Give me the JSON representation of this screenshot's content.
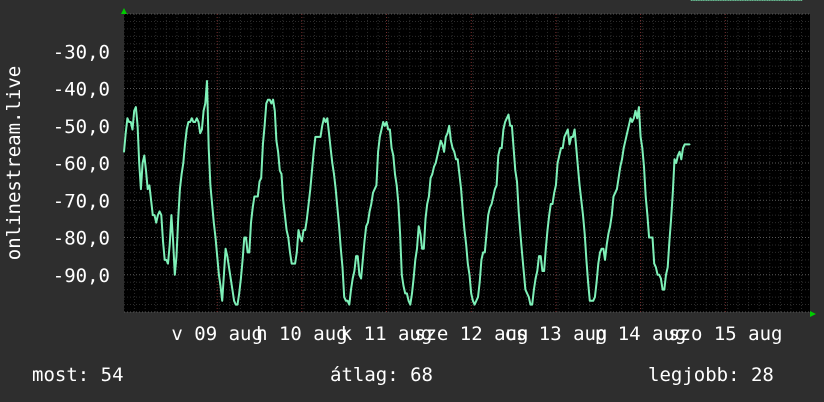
{
  "chart_data": {
    "type": "line",
    "ylabel": "onlinestream.live",
    "ylim": [
      -100,
      -20
    ],
    "yticks": [
      -30,
      -40,
      -50,
      -60,
      -70,
      -80,
      -90
    ],
    "ytick_labels": [
      "-30,0",
      "-40,0",
      "-50,0",
      "-60,0",
      "-70,0",
      "-80,0",
      "-90,0"
    ],
    "xlim": [
      -1.1,
      7.0
    ],
    "xticks": [
      0,
      1,
      2,
      3,
      4,
      5,
      6
    ],
    "xtick_labels": [
      "v 09 aug",
      "h 10 aug",
      "k 11 aug",
      "sze 12 aug",
      "cs 13 aug",
      "p 14 aug",
      "szo 15 aug"
    ],
    "grid": true,
    "colors": {
      "line": "#7ef0b8",
      "background": "#000000",
      "page": "#2e2e2e",
      "grid": "#555555",
      "arrow": "#00cc00"
    },
    "x": [
      -1.1,
      -1.08,
      -1.06,
      -1.04,
      -1.02,
      -1.0,
      -0.98,
      -0.96,
      -0.94,
      -0.92,
      -0.9,
      -0.88,
      -0.86,
      -0.84,
      -0.82,
      -0.8,
      -0.78,
      -0.76,
      -0.74,
      -0.72,
      -0.7,
      -0.68,
      -0.66,
      -0.64,
      -0.62,
      -0.6,
      -0.58,
      -0.56,
      -0.54,
      -0.52,
      -0.5,
      -0.48,
      -0.46,
      -0.44,
      -0.42,
      -0.4,
      -0.38,
      -0.36,
      -0.34,
      -0.32,
      -0.3,
      -0.28,
      -0.26,
      -0.24,
      -0.22,
      -0.2,
      -0.18,
      -0.16,
      -0.14,
      -0.12,
      -0.1,
      -0.08,
      -0.06,
      -0.04,
      -0.02,
      0.0,
      0.02,
      0.04,
      0.06,
      0.08,
      0.1,
      0.12,
      0.14,
      0.16,
      0.18,
      0.2,
      0.22,
      0.24,
      0.26,
      0.28,
      0.3,
      0.32,
      0.34,
      0.36,
      0.38,
      0.4,
      0.42,
      0.44,
      0.46,
      0.48,
      0.5,
      0.52,
      0.54,
      0.56,
      0.58,
      0.6,
      0.62,
      0.64,
      0.66,
      0.68,
      0.7,
      0.72,
      0.74,
      0.76,
      0.78,
      0.8,
      0.82,
      0.84,
      0.86,
      0.88,
      0.9,
      0.92,
      0.94,
      0.96,
      0.98,
      1.0,
      1.02,
      1.04,
      1.06,
      1.08,
      1.1,
      1.12,
      1.14,
      1.16,
      1.18,
      1.2,
      1.22,
      1.24,
      1.26,
      1.28,
      1.3,
      1.32,
      1.34,
      1.36,
      1.38,
      1.4,
      1.42,
      1.44,
      1.46,
      1.48,
      1.5,
      1.52,
      1.54,
      1.56,
      1.58,
      1.6,
      1.62,
      1.64,
      1.66,
      1.68,
      1.7,
      1.72,
      1.74,
      1.76,
      1.78,
      1.8,
      1.82,
      1.84,
      1.86,
      1.88,
      1.9,
      1.92,
      1.94,
      1.96,
      1.98,
      2.0,
      2.02,
      2.04,
      2.06,
      2.08,
      2.1,
      2.12,
      2.14,
      2.16,
      2.18,
      2.2,
      2.22,
      2.24,
      2.26,
      2.28,
      2.3,
      2.32,
      2.34,
      2.36,
      2.38,
      2.4,
      2.42,
      2.44,
      2.46,
      2.48,
      2.5,
      2.52,
      2.54,
      2.56,
      2.58,
      2.6,
      2.62,
      2.64,
      2.66,
      2.68,
      2.7,
      2.72,
      2.74,
      2.76,
      2.78,
      2.8,
      2.82,
      2.84,
      2.86,
      2.88,
      2.9,
      2.92,
      2.94,
      2.96,
      2.98,
      3.0,
      3.02,
      3.04,
      3.06,
      3.08,
      3.1,
      3.12,
      3.14,
      3.16,
      3.18,
      3.2,
      3.22,
      3.24,
      3.26,
      3.28,
      3.3,
      3.32,
      3.34,
      3.36,
      3.38,
      3.4,
      3.42,
      3.44,
      3.46,
      3.48,
      3.5,
      3.52,
      3.54,
      3.56,
      3.58,
      3.6,
      3.62,
      3.64,
      3.66,
      3.68,
      3.7,
      3.72,
      3.74,
      3.76,
      3.78,
      3.8,
      3.82,
      3.84,
      3.86,
      3.88,
      3.9,
      3.92,
      3.94,
      3.96,
      3.98,
      4.0,
      4.02,
      4.04,
      4.06,
      4.08,
      4.1,
      4.12,
      4.14,
      4.16,
      4.18,
      4.2,
      4.22,
      4.24,
      4.26,
      4.28,
      4.3,
      4.32,
      4.34,
      4.36,
      4.38,
      4.4,
      4.42,
      4.44,
      4.46,
      4.48,
      4.5,
      4.52,
      4.54,
      4.56,
      4.58,
      4.6,
      4.62,
      4.64,
      4.66,
      4.68,
      4.7,
      4.72,
      4.74,
      4.76,
      4.78,
      4.8,
      4.82,
      4.84,
      4.86,
      4.88,
      4.9,
      4.92,
      4.94,
      4.96,
      4.98,
      5.0,
      5.02,
      5.04,
      5.06,
      5.08,
      5.1,
      5.12,
      5.14,
      5.16,
      5.18,
      5.2,
      5.22,
      5.24,
      5.26,
      5.28,
      5.3,
      5.32,
      5.34,
      5.36,
      5.38,
      5.4,
      5.42,
      5.44,
      5.46,
      5.48,
      5.5,
      5.52,
      5.54,
      5.56,
      5.58,
      5.6,
      5.62,
      5.64,
      5.66,
      5.68,
      5.7,
      5.72,
      5.74,
      5.76,
      5.78,
      5.8,
      5.82,
      5.84,
      5.86,
      5.88,
      5.9,
      5.92,
      5.94,
      5.96,
      5.98,
      6.0,
      6.02,
      6.04,
      6.06,
      6.08,
      6.1,
      6.12,
      6.14,
      6.16,
      6.18,
      6.2,
      6.22,
      6.24,
      6.26,
      6.28,
      6.3,
      6.32,
      6.34,
      6.36,
      6.38,
      6.4,
      6.42,
      6.44,
      6.46,
      6.48,
      6.5,
      6.52,
      6.54,
      6.56,
      6.58,
      6.6,
      6.62,
      6.64,
      6.66,
      6.68,
      6.7,
      6.72,
      6.74,
      6.76,
      6.78,
      6.8,
      6.82,
      6.84,
      6.86,
      6.88,
      6.9
    ],
    "values": [
      -57,
      -52,
      -48,
      -49,
      -49,
      -51,
      -46,
      -45,
      -50,
      -60,
      -67,
      -60,
      -58,
      -62,
      -67,
      -66,
      -70,
      -74,
      -74,
      -76,
      -74,
      -73,
      -74,
      -81,
      -86,
      -86,
      -87,
      -82,
      -74,
      -81,
      -90,
      -85,
      -75,
      -67,
      -63,
      -60,
      -55,
      -51,
      -49,
      -49,
      -48,
      -49,
      -49,
      -48,
      -49,
      -52,
      -51,
      -46,
      -44,
      -38,
      -56,
      -66,
      -71,
      -76,
      -80,
      -85,
      -90,
      -93,
      -97,
      -90,
      -83,
      -85,
      -88,
      -91,
      -94,
      -97,
      -98,
      -98,
      -95,
      -91,
      -86,
      -80,
      -80,
      -84,
      -84,
      -76,
      -72,
      -69,
      -69,
      -69,
      -65,
      -64,
      -55,
      -50,
      -44,
      -43,
      -43,
      -44,
      -43,
      -46,
      -54,
      -57,
      -62,
      -63,
      -70,
      -74,
      -78,
      -80,
      -84,
      -87,
      -87,
      -87,
      -84,
      -78,
      -80,
      -81,
      -78,
      -78,
      -75,
      -71,
      -67,
      -62,
      -57,
      -53,
      -53,
      -53,
      -53,
      -50,
      -48,
      -49,
      -48,
      -52,
      -56,
      -60,
      -63,
      -67,
      -72,
      -77,
      -83,
      -88,
      -96,
      -97,
      -97,
      -98,
      -94,
      -91,
      -89,
      -85,
      -85,
      -90,
      -91,
      -86,
      -81,
      -77,
      -76,
      -73,
      -71,
      -68,
      -67,
      -66,
      -57,
      -53,
      -51,
      -49,
      -50,
      -49,
      -51,
      -51,
      -56,
      -58,
      -63,
      -66,
      -71,
      -79,
      -90,
      -93,
      -95,
      -95,
      -97,
      -98,
      -95,
      -91,
      -86,
      -83,
      -77,
      -79,
      -83,
      -83,
      -75,
      -71,
      -69,
      -64,
      -63,
      -61,
      -60,
      -58,
      -56,
      -54,
      -55,
      -57,
      -53,
      -52,
      -50,
      -54,
      -56,
      -57,
      -59,
      -59,
      -63,
      -67,
      -73,
      -78,
      -82,
      -87,
      -90,
      -95,
      -97,
      -98,
      -97,
      -96,
      -92,
      -86,
      -84,
      -84,
      -79,
      -74,
      -72,
      -71,
      -69,
      -67,
      -66,
      -58,
      -56,
      -56,
      -51,
      -49,
      -48,
      -47,
      -50,
      -50,
      -56,
      -62,
      -65,
      -73,
      -79,
      -84,
      -89,
      -94,
      -95,
      -96,
      -98,
      -98,
      -94,
      -91,
      -89,
      -85,
      -85,
      -89,
      -89,
      -83,
      -78,
      -74,
      -71,
      -71,
      -68,
      -66,
      -60,
      -58,
      -56,
      -56,
      -53,
      -52,
      -51,
      -55,
      -53,
      -53,
      -51,
      -56,
      -61,
      -66,
      -70,
      -74,
      -79,
      -86,
      -92,
      -97,
      -97,
      -97,
      -96,
      -92,
      -87,
      -84,
      -83,
      -83,
      -86,
      -82,
      -79,
      -77,
      -74,
      -69,
      -68,
      -67,
      -64,
      -61,
      -59,
      -56,
      -54,
      -52,
      -50,
      -48,
      -49,
      -48,
      -46,
      -48,
      -45,
      -53,
      -56,
      -61,
      -69,
      -74,
      -80,
      -80,
      -80,
      -87,
      -88,
      -90,
      -90,
      -91,
      -94,
      -94,
      -90,
      -88,
      -81,
      -75,
      -68,
      -59,
      -60,
      -58,
      -57,
      -59,
      -56,
      -55,
      -55,
      -55,
      -55
    ]
  },
  "stats": {
    "now": "most: 54",
    "avg": "átlag: 68",
    "max": "legjobb: 28"
  }
}
